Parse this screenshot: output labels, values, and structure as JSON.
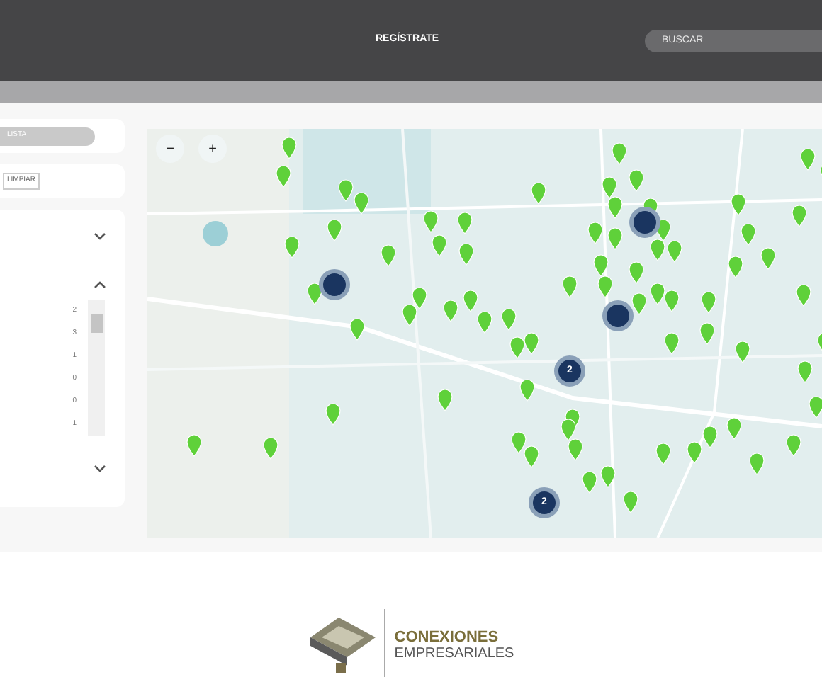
{
  "header": {
    "register_link": "REGÍSTRATE",
    "search": {
      "placeholder": "BUSCAR"
    }
  },
  "sidebar": {
    "list_button": "LISTA",
    "clear_button": "LIMPIAR",
    "filter": {
      "counts": [
        "2",
        "3",
        "1",
        "0",
        "0",
        "1"
      ]
    }
  },
  "map": {
    "zoom_out": "−",
    "zoom_in": "+",
    "clusters": [
      {
        "count": "2"
      },
      {
        "count": "2"
      }
    ]
  },
  "footer": {
    "logo_line_1": "CONEXIONES",
    "logo_line_2": "EMPRESARIALES"
  }
}
